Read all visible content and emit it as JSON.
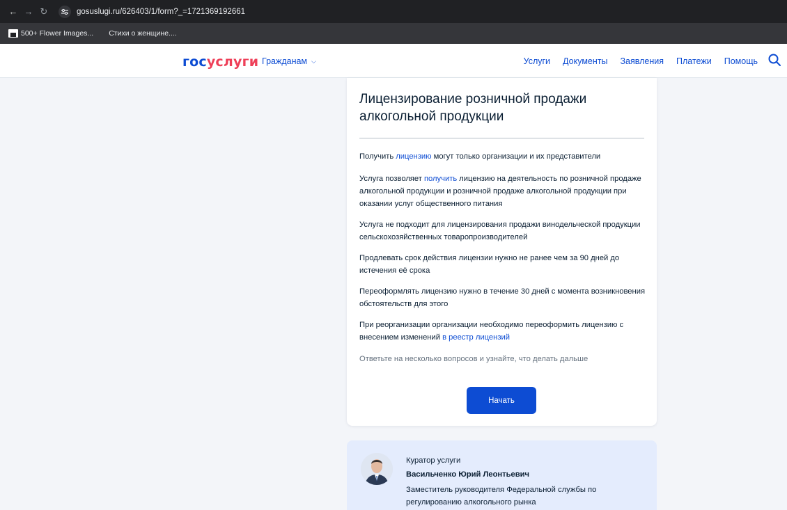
{
  "browser": {
    "url": "gosuslugi.ru/626403/1/form?_=1721369192661",
    "bookmarks": [
      "500+ Flower Images...",
      "Стихи о женщине...."
    ]
  },
  "header": {
    "logo_part1": "гос",
    "logo_part2": "услуги",
    "audience": "Гражданам",
    "nav": [
      "Услуги",
      "Документы",
      "Заявления",
      "Платежи",
      "Помощь"
    ]
  },
  "card": {
    "title": "Лицензирование розничной продажи алкогольной продукции",
    "p1_pre": "Получить ",
    "p1_link": "лицензию",
    "p1_post": " могут только организации и их представители",
    "p2_pre": "Услуга позволяет ",
    "p2_link": "получить",
    "p2_post": " лицензию на деятельность по розничной продаже алкогольной продукции и розничной продаже алкогольной продукции при оказании услуг общественного питания",
    "p3": "Услуга не подходит для лицензирования продажи винодельческой продукции сельскохозяйственных товаропроизводителей",
    "p4": "Продлевать срок действия лицензии нужно не ранее чем за 90 дней до истечения её срока",
    "p5": "Переоформлять лицензию нужно в течение 30 дней с момента возникновения обстоятельств для этого",
    "p6_pre": "При реорганизации организации необходимо переоформить лицензию с внесением изменений ",
    "p6_link": "в реестр лицензий",
    "hint": "Ответьте на несколько вопросов и узнайте, что делать дальше",
    "start_label": "Начать"
  },
  "curator": {
    "label": "Куратор услуги",
    "name": "Васильченко Юрий Леонтьевич",
    "role": "Заместитель руководителя Федеральной службы по регулированию алкогольного рынка"
  },
  "colors": {
    "brand_blue": "#0d4cd3",
    "brand_red": "#ee3f58",
    "page_bg": "#f3f5f9",
    "curator_bg": "#e4ecfd"
  }
}
